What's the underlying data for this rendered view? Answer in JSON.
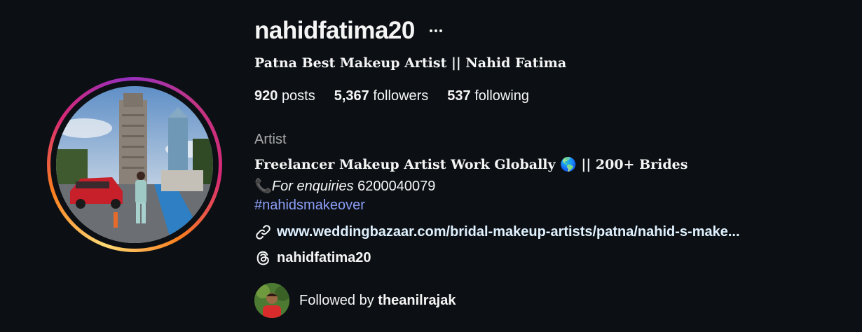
{
  "profile": {
    "username": "nahidfatima20",
    "full_name": "Patna Best Makeup Artist || Nahid Fatima",
    "stats": {
      "posts_count": "920",
      "posts_label": "posts",
      "followers_count": "5,367",
      "followers_label": "followers",
      "following_count": "537",
      "following_label": "following"
    },
    "category": "Artist",
    "bio": {
      "line1": "Freelancer Makeup Artist Work Globally 🌎 || 200+ Brides",
      "line2_emoji": "📞",
      "line2_italic": "For enquiries",
      "line2_phone": " 6200040079",
      "hashtag": "#nahidsmakeover"
    },
    "link": "www.weddingbazaar.com/bridal-makeup-artists/patna/nahid-s-make...",
    "threads_handle": "nahidfatima20",
    "followed_by_label": "Followed by",
    "followed_by_user": "theanilrajak"
  },
  "icons": {
    "more": "more-options-icon",
    "link": "link-icon",
    "threads": "threads-icon"
  },
  "colors": {
    "background": "#0c1014",
    "text": "#f5f5f5",
    "muted": "#a8a8a8",
    "hashtag": "#8c9ef7",
    "link": "#e0f1ff"
  }
}
